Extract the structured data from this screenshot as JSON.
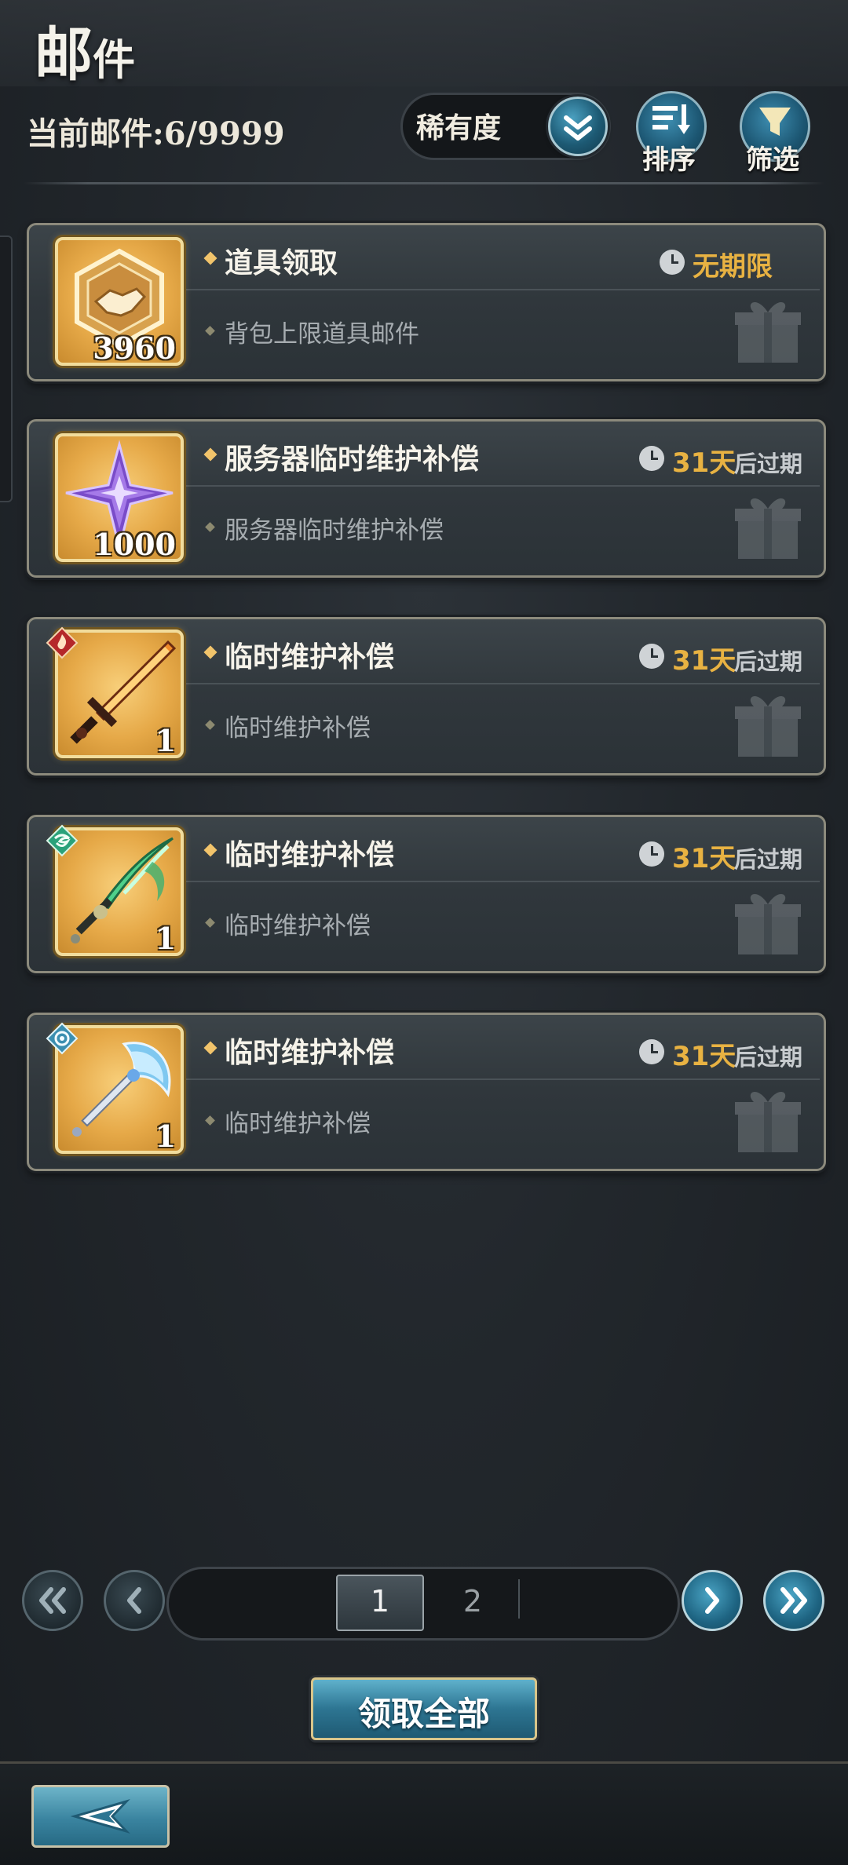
{
  "header": {
    "title_first": "邮",
    "title_second": "件",
    "mail_count": "当前邮件:6/9999",
    "sort_dropdown": {
      "selected": "稀有度"
    },
    "sort_button_label": "排序",
    "filter_button_label": "筛选"
  },
  "mails": [
    {
      "title": "道具领取",
      "subtitle": "背包上限道具邮件",
      "item_count": "3960",
      "item_icon": "handshake-badge-icon",
      "expiry_value": "",
      "expiry_suffix": "",
      "expiry_text": "无期限"
    },
    {
      "title": "服务器临时维护补偿",
      "subtitle": "服务器临时维护补偿",
      "item_count": "1000",
      "item_icon": "purple-star-crystal-icon",
      "expiry_value": "31天",
      "expiry_suffix": "后过期",
      "expiry_text": ""
    },
    {
      "title": "临时维护补偿",
      "subtitle": "临时维护补偿",
      "item_count": "1",
      "item_icon": "fire-sword-icon",
      "element_icon": "fire-element-icon",
      "expiry_value": "31天",
      "expiry_suffix": "后过期",
      "expiry_text": ""
    },
    {
      "title": "临时维护补偿",
      "subtitle": "临时维护补偿",
      "item_count": "1",
      "item_icon": "wind-sword-icon",
      "element_icon": "wind-element-icon",
      "expiry_value": "31天",
      "expiry_suffix": "后过期",
      "expiry_text": ""
    },
    {
      "title": "临时维护补偿",
      "subtitle": "临时维护补偿",
      "item_count": "1",
      "item_icon": "ice-axe-icon",
      "element_icon": "ice-element-icon",
      "expiry_value": "31天",
      "expiry_suffix": "后过期",
      "expiry_text": ""
    }
  ],
  "pagination": {
    "pages": [
      "1",
      "2"
    ],
    "current": "1"
  },
  "footer": {
    "claim_all_label": "领取全部"
  },
  "colors": {
    "accent_gold": "#e8b242",
    "accent_blue": "#2d7592",
    "card_border": "#8c8a7c"
  }
}
